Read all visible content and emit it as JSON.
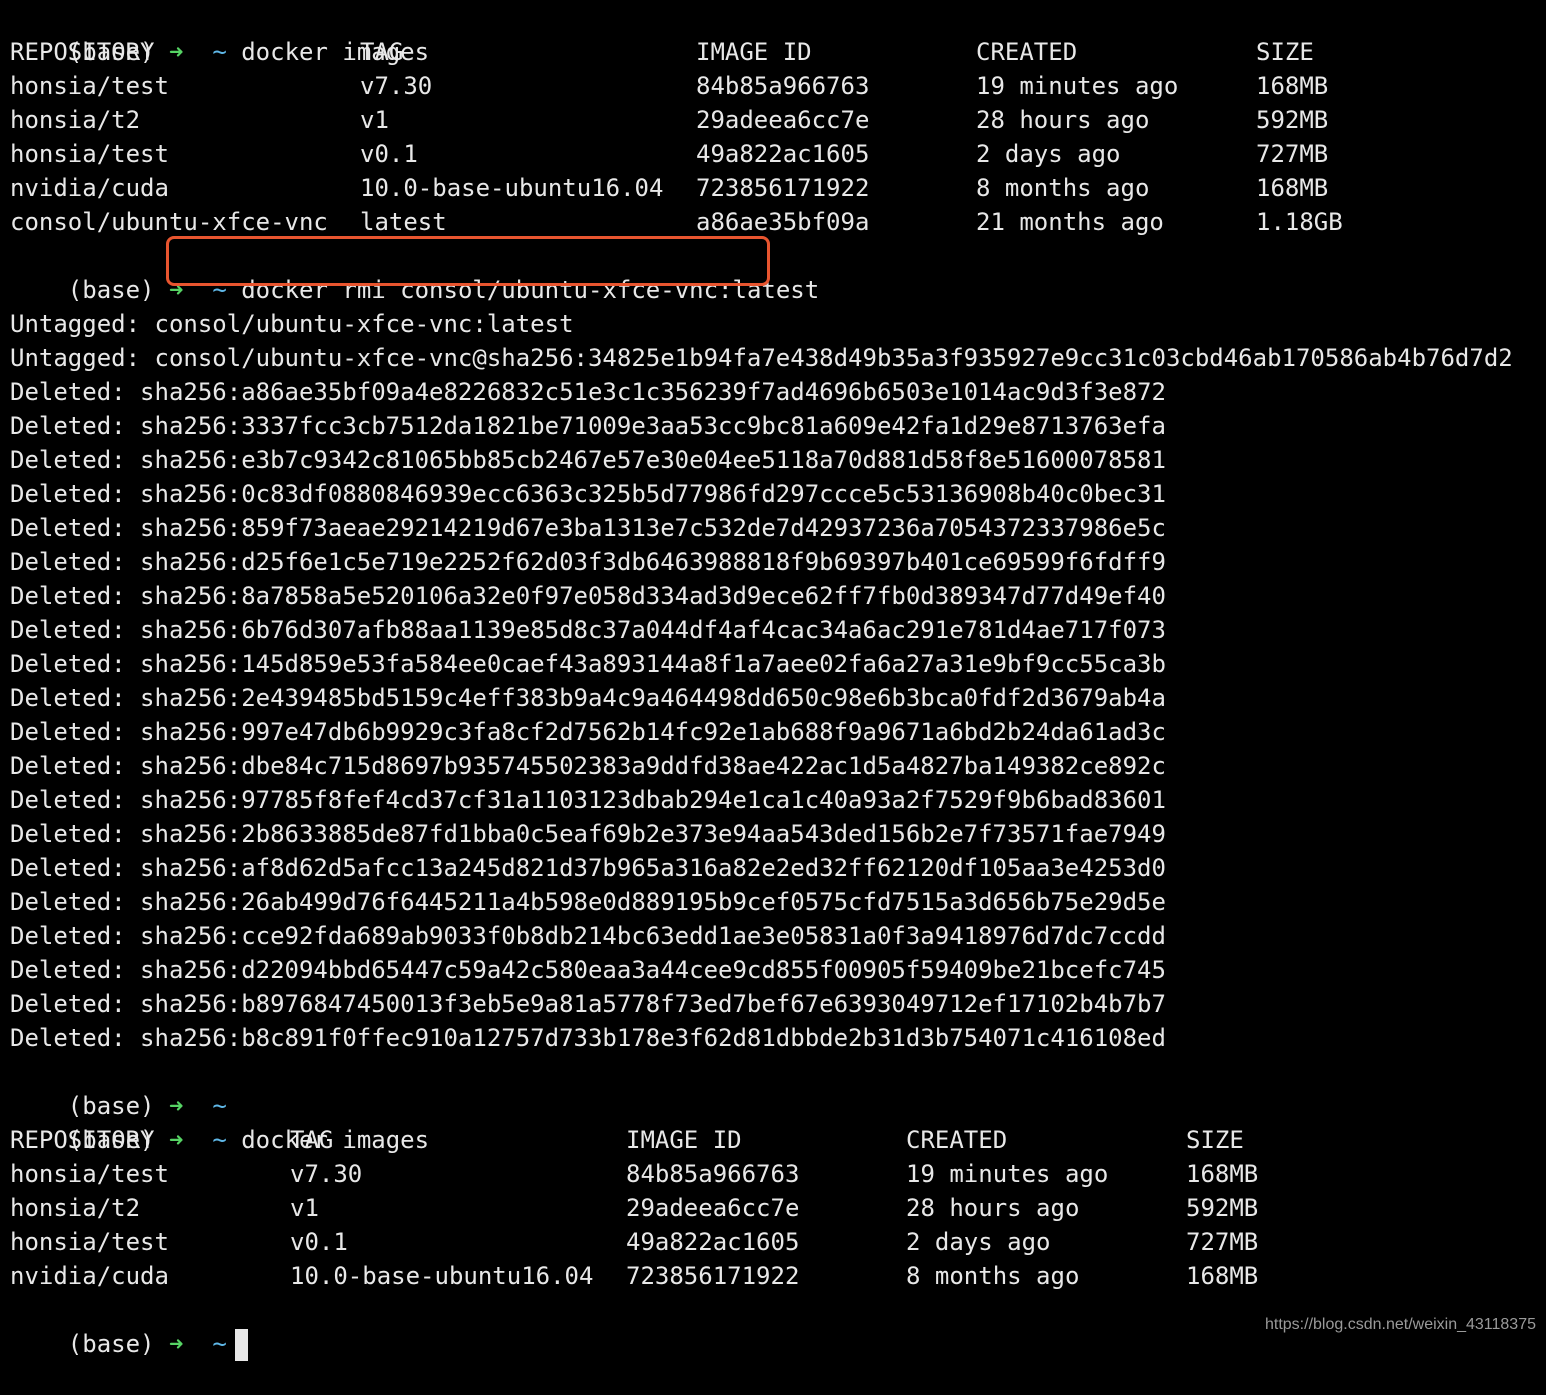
{
  "prompt": {
    "env": "(base)",
    "arrow": "➜",
    "dir": "~"
  },
  "colors": {
    "background": "#000000",
    "text": "#e8e8e8",
    "arrow": "#56d364",
    "dir": "#5fb8e8",
    "highlight": "#e8552f"
  },
  "commands": {
    "first": "docker images",
    "rmi": "docker rmi consol/ubuntu-xfce-vnc:latest",
    "second": "docker images"
  },
  "table_headers": {
    "repository": "REPOSITORY",
    "tag": "TAG",
    "image_id": "IMAGE ID",
    "created": "CREATED",
    "size": "SIZE"
  },
  "images_before": [
    {
      "repository": "honsia/test",
      "tag": "v7.30",
      "image_id": "84b85a966763",
      "created": "19 minutes ago",
      "size": "168MB"
    },
    {
      "repository": "honsia/t2",
      "tag": "v1",
      "image_id": "29adeea6cc7e",
      "created": "28 hours ago",
      "size": "592MB"
    },
    {
      "repository": "honsia/test",
      "tag": "v0.1",
      "image_id": "49a822ac1605",
      "created": "2 days ago",
      "size": "727MB"
    },
    {
      "repository": "nvidia/cuda",
      "tag": "10.0-base-ubuntu16.04",
      "image_id": "723856171922",
      "created": "8 months ago",
      "size": "168MB"
    },
    {
      "repository": "consol/ubuntu-xfce-vnc",
      "tag": "latest",
      "image_id": "a86ae35bf09a",
      "created": "21 months ago",
      "size": "1.18GB"
    }
  ],
  "rmi_output": [
    "Untagged: consol/ubuntu-xfce-vnc:latest",
    "Untagged: consol/ubuntu-xfce-vnc@sha256:34825e1b94fa7e438d49b35a3f935927e9cc31c03cbd46ab170586ab4b76d7d2",
    "Deleted: sha256:a86ae35bf09a4e8226832c51e3c1c356239f7ad4696b6503e1014ac9d3f3e872",
    "Deleted: sha256:3337fcc3cb7512da1821be71009e3aa53cc9bc81a609e42fa1d29e8713763efa",
    "Deleted: sha256:e3b7c9342c81065bb85cb2467e57e30e04ee5118a70d881d58f8e51600078581",
    "Deleted: sha256:0c83df0880846939ecc6363c325b5d77986fd297ccce5c53136908b40c0bec31",
    "Deleted: sha256:859f73aeae29214219d67e3ba1313e7c532de7d42937236a7054372337986e5c",
    "Deleted: sha256:d25f6e1c5e719e2252f62d03f3db6463988818f9b69397b401ce69599f6fdff9",
    "Deleted: sha256:8a7858a5e520106a32e0f97e058d334ad3d9ece62ff7fb0d389347d77d49ef40",
    "Deleted: sha256:6b76d307afb88aa1139e85d8c37a044df4af4cac34a6ac291e781d4ae717f073",
    "Deleted: sha256:145d859e53fa584ee0caef43a893144a8f1a7aee02fa6a27a31e9bf9cc55ca3b",
    "Deleted: sha256:2e439485bd5159c4eff383b9a4c9a464498dd650c98e6b3bca0fdf2d3679ab4a",
    "Deleted: sha256:997e47db6b9929c3fa8cf2d7562b14fc92e1ab688f9a9671a6bd2b24da61ad3c",
    "Deleted: sha256:dbe84c715d8697b935745502383a9ddfd38ae422ac1d5a4827ba149382ce892c",
    "Deleted: sha256:97785f8fef4cd37cf31a1103123dbab294e1ca1c40a93a2f7529f9b6bad83601",
    "Deleted: sha256:2b8633885de87fd1bba0c5eaf69b2e373e94aa543ded156b2e7f73571fae7949",
    "Deleted: sha256:af8d62d5afcc13a245d821d37b965a316a82e2ed32ff62120df105aa3e4253d0",
    "Deleted: sha256:26ab499d76f6445211a4b598e0d889195b9cef0575cfd7515a3d656b75e29d5e",
    "Deleted: sha256:cce92fda689ab9033f0b8db214bc63edd1ae3e05831a0f3a9418976d7dc7ccdd",
    "Deleted: sha256:d22094bbd65447c59a42c580eaa3a44cee9cd855f00905f59409be21bcefc745",
    "Deleted: sha256:b8976847450013f3eb5e9a81a5778f73ed7bef67e6393049712ef17102b4b7b7",
    "Deleted: sha256:b8c891f0ffec910a12757d733b178e3f62d81dbbde2b31d3b754071c416108ed"
  ],
  "images_after": [
    {
      "repository": "honsia/test",
      "tag": "v7.30",
      "image_id": "84b85a966763",
      "created": "19 minutes ago",
      "size": "168MB"
    },
    {
      "repository": "honsia/t2",
      "tag": "v1",
      "image_id": "29adeea6cc7e",
      "created": "28 hours ago",
      "size": "592MB"
    },
    {
      "repository": "honsia/test",
      "tag": "v0.1",
      "image_id": "49a822ac1605",
      "created": "2 days ago",
      "size": "727MB"
    },
    {
      "repository": "nvidia/cuda",
      "tag": "10.0-base-ubuntu16.04",
      "image_id": "723856171922",
      "created": "8 months ago",
      "size": "168MB"
    }
  ],
  "watermark": "https://blog.csdn.net/weixin_43118375"
}
